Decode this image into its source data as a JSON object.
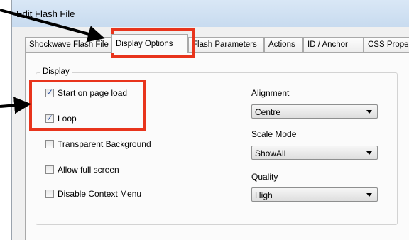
{
  "window": {
    "title": "Edit Flash File"
  },
  "tabs": [
    {
      "label": "Shockwave Flash File"
    },
    {
      "label": "Display Options"
    },
    {
      "label": "Flash Parameters"
    },
    {
      "label": "Actions"
    },
    {
      "label": "ID / Anchor"
    },
    {
      "label": "CSS Properties"
    }
  ],
  "display": {
    "legend": "Display",
    "checkboxes": [
      {
        "label": "Start on page load",
        "checked": true
      },
      {
        "label": "Loop",
        "checked": true
      },
      {
        "label": "Transparent Background",
        "checked": false
      },
      {
        "label": "Allow full screen",
        "checked": false
      },
      {
        "label": "Disable Context Menu",
        "checked": false
      }
    ],
    "alignment": {
      "label": "Alignment",
      "value": "Centre"
    },
    "scale_mode": {
      "label": "Scale Mode",
      "value": "ShowAll"
    },
    "quality": {
      "label": "Quality",
      "value": "High"
    }
  },
  "colors": {
    "highlight": "#e8341c",
    "arrow": "#000000"
  },
  "check_glyph": "✓"
}
